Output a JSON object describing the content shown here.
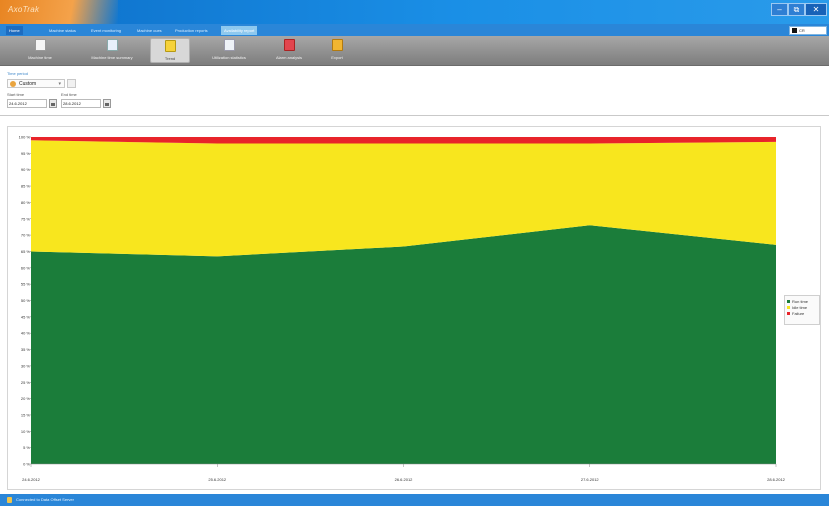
{
  "window": {
    "app_title": "AxoTrak",
    "buttons": {
      "minimize": "–",
      "restore": "⧉",
      "close": "✕"
    }
  },
  "tabs": {
    "home": "Home",
    "items": [
      "Machine status",
      "Event monitoring",
      "Machine cues",
      "Production reports",
      "Availability report"
    ],
    "search_value": "CR"
  },
  "ribbon": {
    "buttons": [
      "Machine time",
      "Machine time summary",
      "Trend",
      "Utilization statistics",
      "Alarm analysis",
      "Export"
    ],
    "active_index": 2,
    "colors": [
      "#f5f5f5",
      "#e8f0fb",
      "#f6d23a",
      "#eef2f7",
      "#e2454e",
      "#f1b531"
    ]
  },
  "period": {
    "title": "Time period",
    "selected": "Custom",
    "start_label": "Start time",
    "end_label": "End time",
    "start_value": "24.6.2012",
    "end_value": "28.6.2012"
  },
  "chart_data": {
    "type": "area",
    "stacked": true,
    "x": [
      "24.6.2012",
      "25.6.2012",
      "26.6.2012",
      "27.6.2012",
      "28.6.2012"
    ],
    "series": [
      {
        "name": "Run time",
        "color": "#1b7d3a",
        "values": [
          65,
          63.5,
          66.5,
          73,
          67
        ]
      },
      {
        "name": "Idle time",
        "color": "#f8e61e",
        "values": [
          34,
          34.5,
          31.5,
          25,
          31.5
        ]
      },
      {
        "name": "Failure",
        "color": "#e8242a",
        "values": [
          1,
          2,
          2,
          2,
          1.5
        ]
      }
    ],
    "ylim": [
      0,
      100
    ],
    "yticks": [
      "0 %",
      "5 %",
      "10 %",
      "15 %",
      "20 %",
      "25 %",
      "30 %",
      "35 %",
      "40 %",
      "45 %",
      "50 %",
      "55 %",
      "60 %",
      "65 %",
      "70 %",
      "75 %",
      "80 %",
      "85 %",
      "90 %",
      "95 %",
      "100 %"
    ],
    "legend": "right"
  },
  "status": {
    "text": "Connected to Data Offset Server"
  }
}
